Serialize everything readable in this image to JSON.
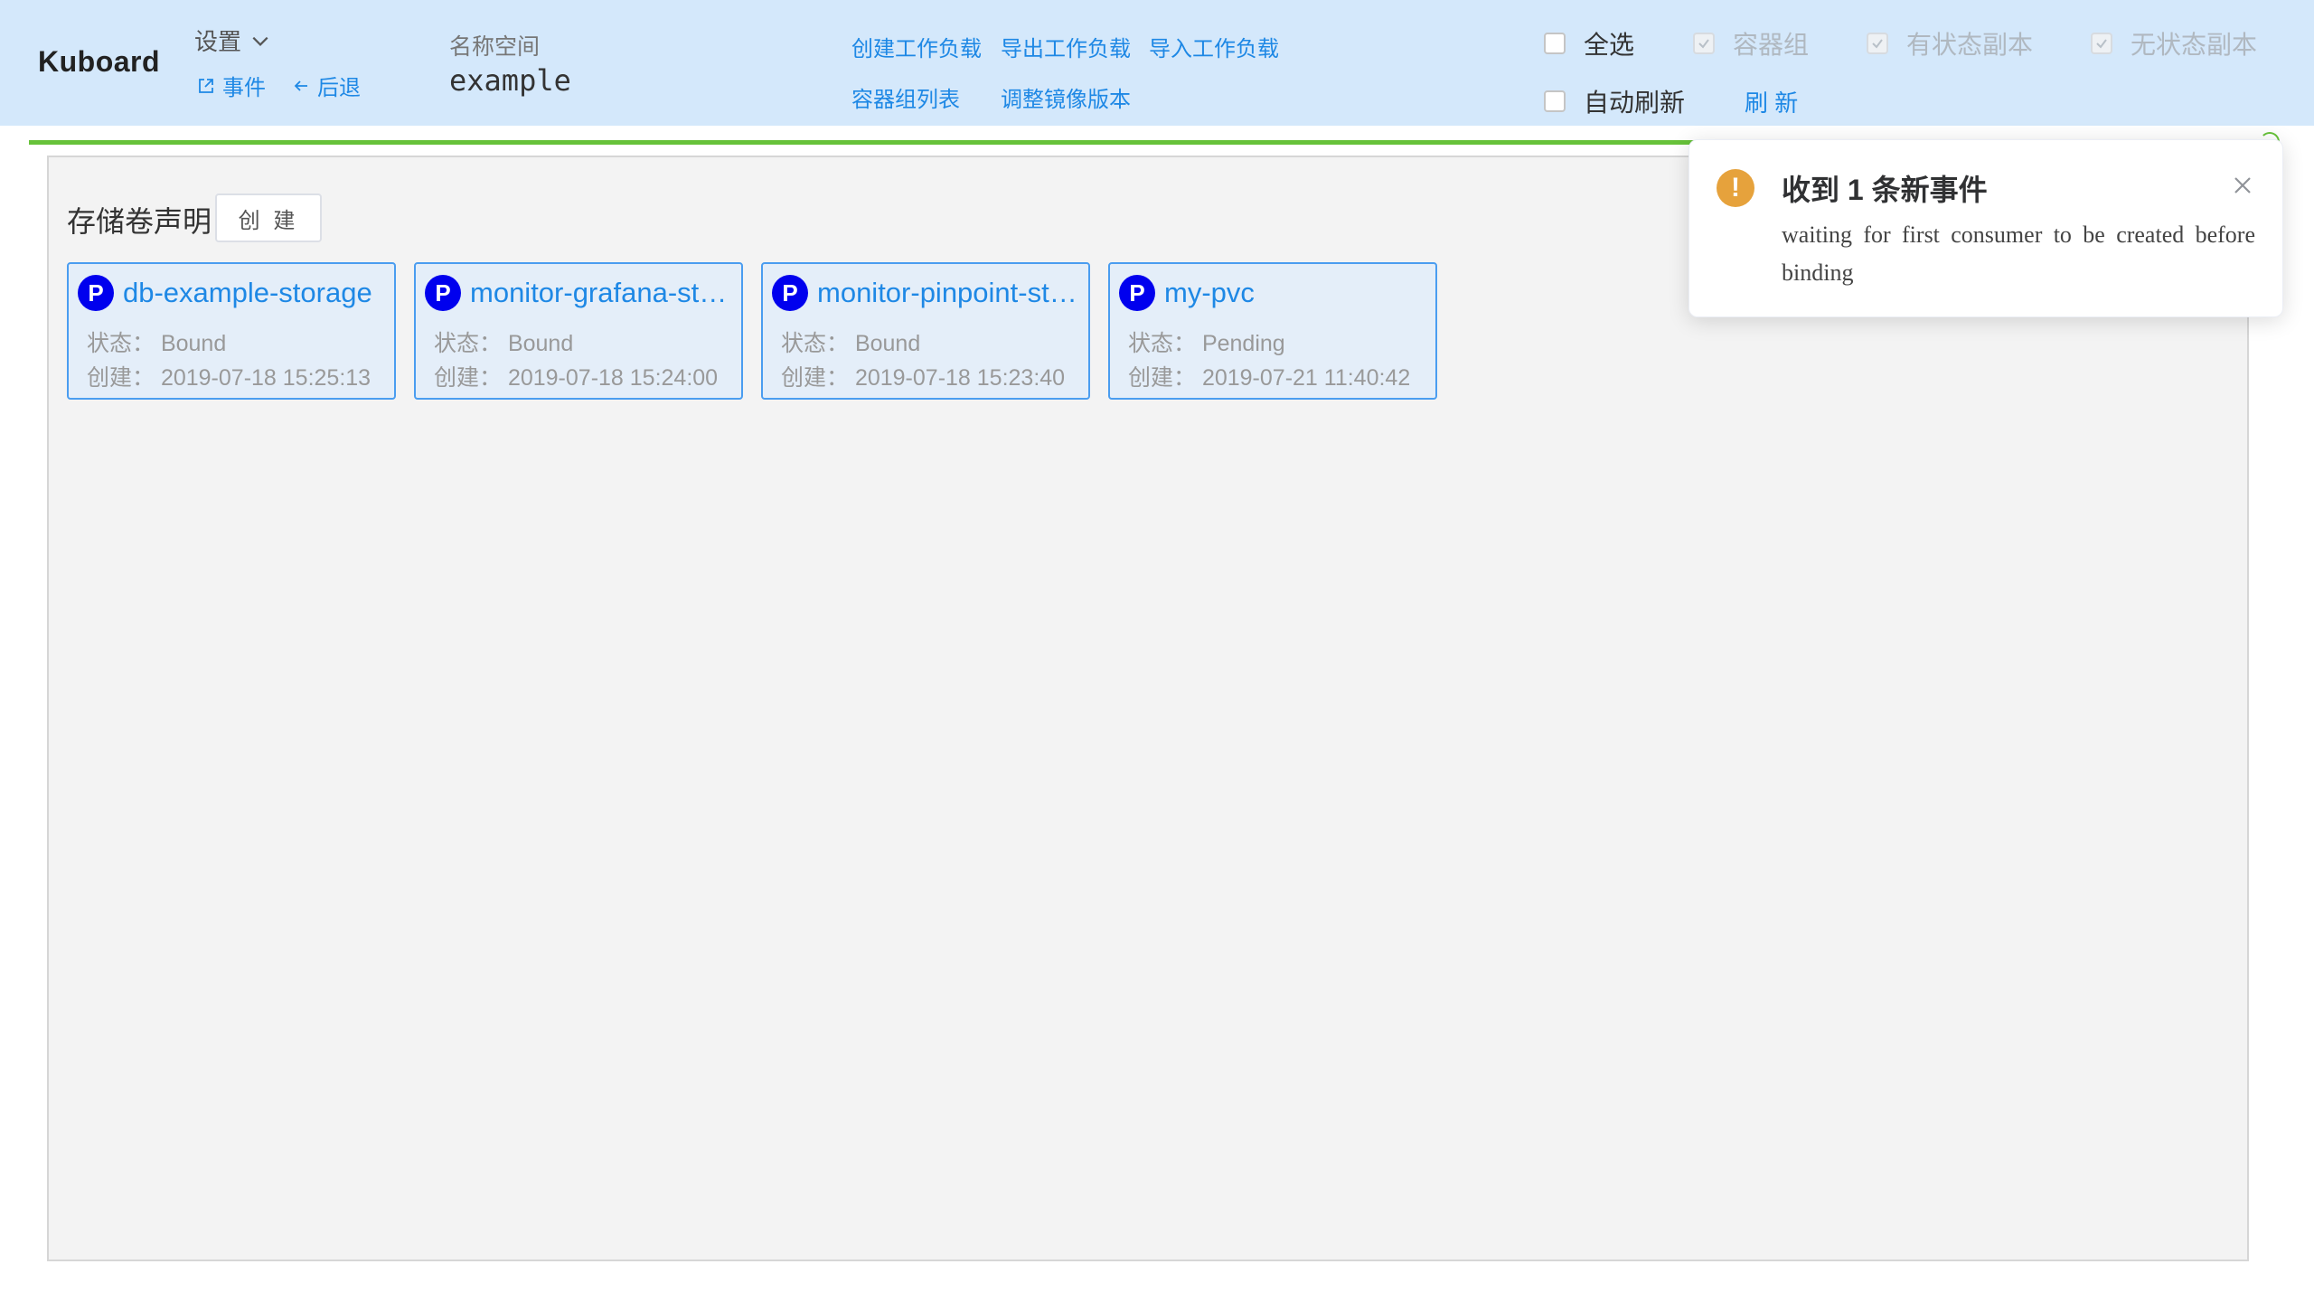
{
  "header": {
    "logo": "Kuboard",
    "settings_label": "设置",
    "events_label": "事件",
    "back_label": "后退",
    "namespace_label": "名称空间",
    "namespace_value": "example",
    "actions": {
      "create_workload": "创建工作负载",
      "export_workload": "导出工作负载",
      "import_workload": "导入工作负载",
      "pod_list": "容器组列表",
      "adjust_image": "调整镜像版本"
    },
    "filters": {
      "select_all": "全选",
      "pods": "容器组",
      "statefulset": "有状态副本",
      "stateless": "无状态副本",
      "auto_refresh": "自动刷新",
      "refresh": "刷 新"
    }
  },
  "section": {
    "title": "存储卷声明",
    "create_button": "创 建"
  },
  "cards": [
    {
      "badge": "P",
      "name": "db-example-storage",
      "status": "状态：  Bound",
      "created": "创建：  2019-07-18 15:25:13"
    },
    {
      "badge": "P",
      "name": "monitor-grafana-storage",
      "status": "状态：  Bound",
      "created": "创建：  2019-07-18 15:24:00"
    },
    {
      "badge": "P",
      "name": "monitor-pinpoint-storage",
      "status": "状态：  Bound",
      "created": "创建：  2019-07-18 15:23:40"
    },
    {
      "badge": "P",
      "name": "my-pvc",
      "status": "状态：  Pending",
      "created": "创建：  2019-07-21 11:40:42"
    }
  ],
  "notification": {
    "icon": "!",
    "title": "收到 1 条新事件",
    "body": "waiting for first consumer to be created before binding"
  },
  "colors": {
    "header_bg": "#d4e8fb",
    "link": "#1e88e5",
    "card_border": "#4a9df0",
    "badge": "#0000ee",
    "warning": "#e6a23c",
    "progress": "#67c23a"
  }
}
